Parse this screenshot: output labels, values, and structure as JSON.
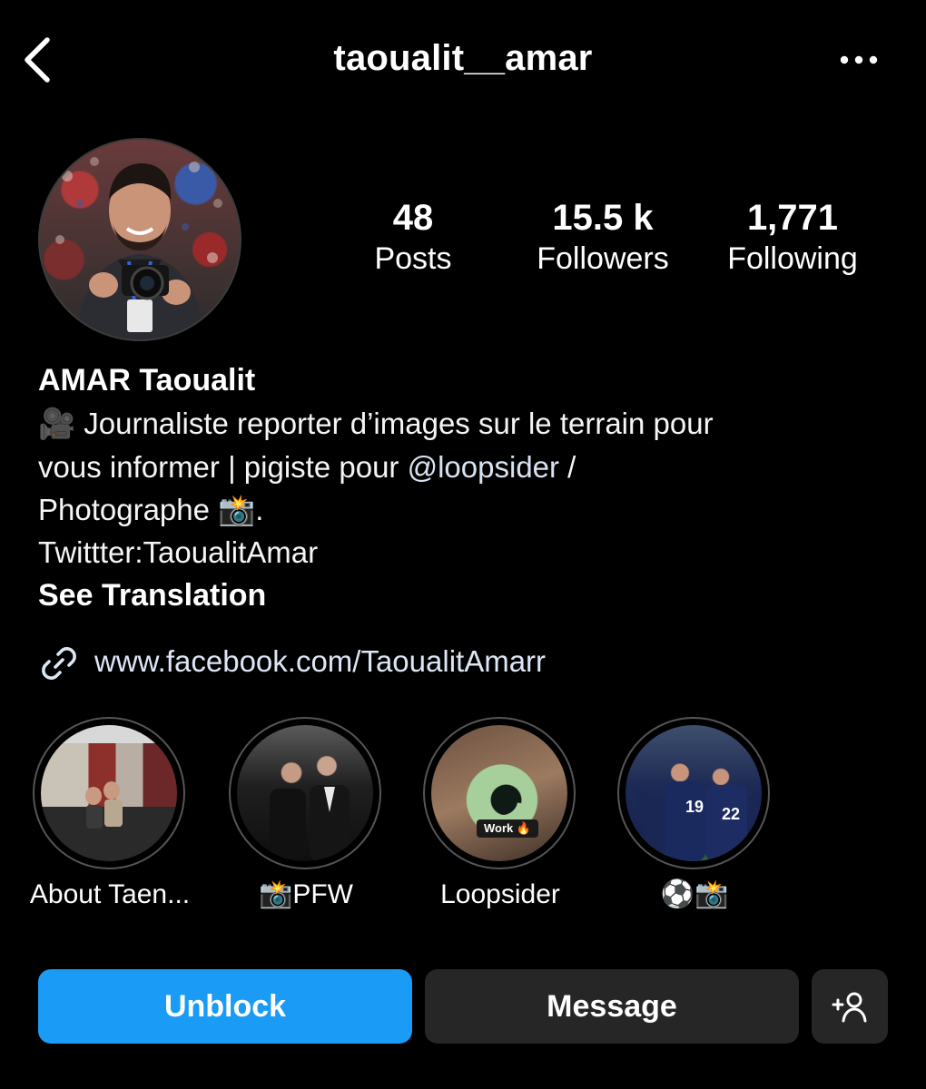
{
  "header": {
    "username": "taoualit__amar",
    "back_icon": "chevron-left-icon",
    "more_icon": "more-horizontal-icon"
  },
  "stats": {
    "posts": {
      "value": "48",
      "label": "Posts"
    },
    "followers": {
      "value": "15.5 k",
      "label": "Followers"
    },
    "following": {
      "value": "1,771",
      "label": "Following"
    }
  },
  "bio": {
    "name": "AMAR Taoualit",
    "line1": "🎥 Journaliste reporter d’images sur le terrain pour",
    "line2_pre": "vous informer | pigiste pour ",
    "line2_mention": "@loopsider",
    "line2_post": " /",
    "line3": "Photographe 📸.",
    "line4": "Twittter:TaoualitAmar",
    "see_translation": "See Translation",
    "link": "www.facebook.com/TaoualitAmarr",
    "link_icon": "link-icon"
  },
  "highlights": [
    {
      "label": "About Taen..."
    },
    {
      "label": "📸PFW"
    },
    {
      "label": "Loopsider",
      "thumb_chip": "Work 🔥"
    },
    {
      "label": "⚽📸"
    }
  ],
  "actions": {
    "unblock": "Unblock",
    "message": "Message",
    "add_user_icon": "add-user-icon"
  },
  "colors": {
    "background": "#000000",
    "primary_button": "#1a9bf5",
    "secondary_button": "#262626",
    "link_text": "#dce6f5"
  }
}
